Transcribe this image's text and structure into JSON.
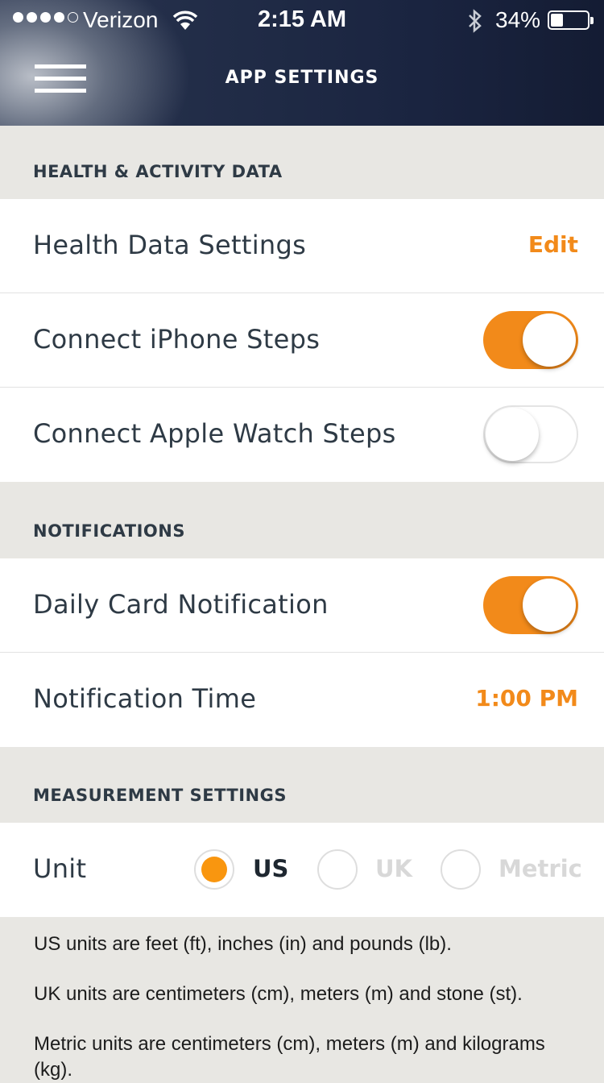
{
  "status_bar": {
    "carrier": "Verizon",
    "time": "2:15 AM",
    "battery_percent": "34%",
    "battery_level": 0.34,
    "signal_bars_filled": 4,
    "signal_bars_total": 5
  },
  "header": {
    "title": "APP SETTINGS",
    "menu_icon": "hamburger-menu-icon"
  },
  "sections": {
    "health": {
      "title": "HEALTH & ACTIVITY DATA",
      "health_data_label": "Health Data Settings",
      "health_data_action": "Edit",
      "iphone_steps_label": "Connect iPhone Steps",
      "iphone_steps_on": true,
      "watch_steps_label": "Connect Apple Watch Steps",
      "watch_steps_on": false
    },
    "notifications": {
      "title": "NOTIFICATIONS",
      "daily_card_label": "Daily Card Notification",
      "daily_card_on": true,
      "time_label": "Notification Time",
      "time_value": "1:00 PM"
    },
    "measurement": {
      "title": "MEASUREMENT SETTINGS",
      "unit_label": "Unit",
      "options": [
        "US",
        "UK",
        "Metric"
      ],
      "selected": "US",
      "info": [
        "US units are feet (ft), inches (in) and pounds (lb).",
        "UK units are centimeters (cm), meters (m) and stone (st).",
        "Metric units are centimeters (cm), meters (m) and kilograms (kg)."
      ]
    }
  },
  "colors": {
    "accent": "#f28a1a",
    "header_bg": "#1f2a45",
    "section_bg": "#e8e7e3",
    "text": "#2e3a45"
  }
}
